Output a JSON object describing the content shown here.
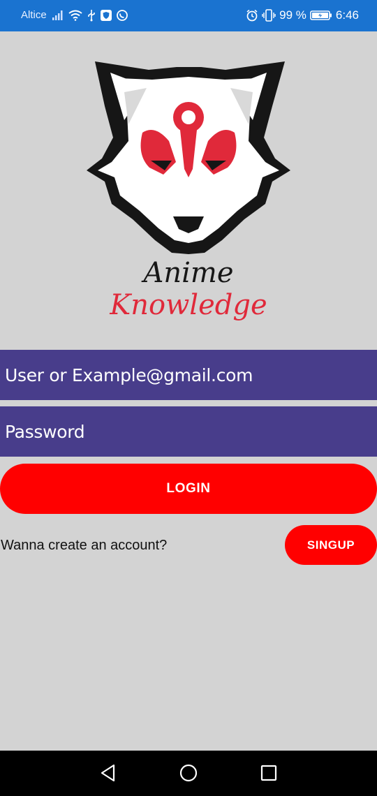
{
  "status_bar": {
    "carrier": "Altice",
    "battery_percent": "99 %",
    "time": "6:46",
    "left_icons": [
      "signal-icon",
      "wifi-icon",
      "usb-icon",
      "shield-app-icon",
      "whatsapp-icon"
    ],
    "right_icons": [
      "alarm-icon",
      "vibrate-icon",
      "battery-icon"
    ],
    "background_color": "#1a73d0"
  },
  "logo": {
    "line1": "Anime",
    "line2": "Knowledge",
    "primary_color": "#e0293a"
  },
  "login_form": {
    "username_placeholder": "User or Example@gmail.com",
    "password_placeholder": "Password",
    "field_color": "#483d8b",
    "login_label": "LOGIN",
    "button_color": "#ff0000"
  },
  "signup": {
    "prompt": "Wanna create an account?",
    "button_label": "SINGUP"
  },
  "nav_bar": {
    "icons": [
      "back-icon",
      "home-icon",
      "recents-icon"
    ]
  }
}
